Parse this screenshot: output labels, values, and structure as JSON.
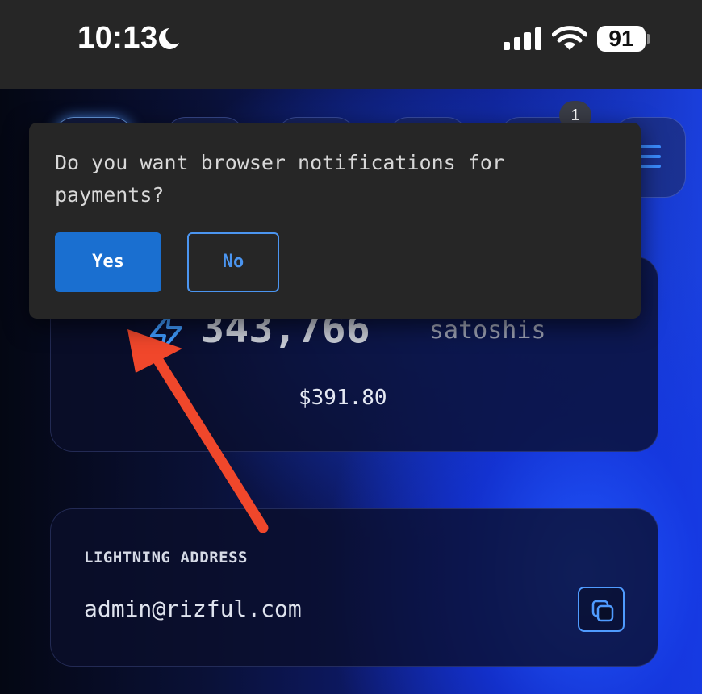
{
  "status_bar": {
    "time": "10:13",
    "battery": "91",
    "icons": [
      "moon-icon",
      "signal-icon",
      "wifi-icon",
      "battery-icon"
    ]
  },
  "nav": {
    "badge_count": "1",
    "icons": [
      "menu-icon"
    ]
  },
  "popup": {
    "message": "Do you want browser notifications for payments?",
    "yes_label": "Yes",
    "no_label": "No"
  },
  "balance": {
    "amount": "343,766",
    "unit": "satoshis",
    "fiat": "$391.80",
    "icon": "lightning-bolt-icon"
  },
  "address": {
    "label": "LIGHTNING ADDRESS",
    "value": "admin@rizful.com",
    "copy_icon": "copy-icon"
  },
  "colors": {
    "accent": "#1a6fd0",
    "accent_outline": "#4b95f0",
    "popup_bg": "#262626",
    "arrow": "#f0472b"
  }
}
